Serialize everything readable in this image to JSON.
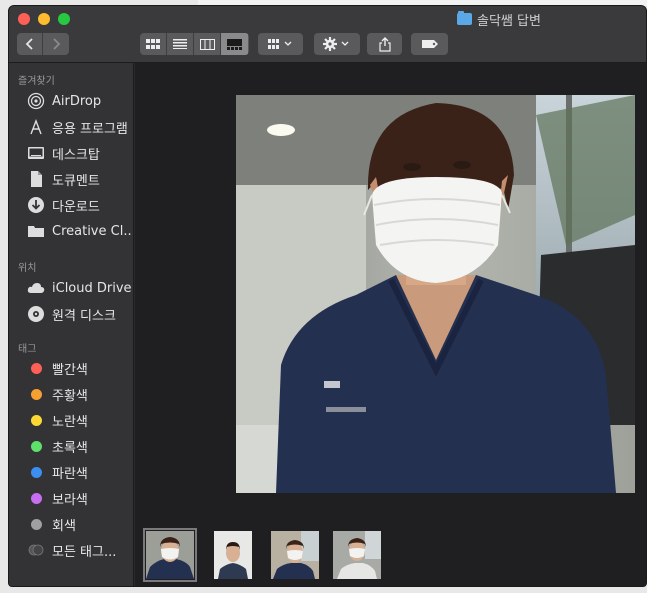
{
  "window": {
    "title": "솔닥쌤 답변"
  },
  "toolbar": {
    "back_icon": "chevron-left-icon",
    "forward_icon": "chevron-right-icon",
    "view_modes": [
      "icon-view",
      "list-view",
      "column-view",
      "gallery-view"
    ],
    "active_view": "gallery-view"
  },
  "sidebar": {
    "favorites_label": "즐겨찾기",
    "favorites": [
      {
        "label": "AirDrop",
        "icon": "airdrop-icon"
      },
      {
        "label": "응용 프로그램",
        "icon": "applications-icon"
      },
      {
        "label": "데스크탑",
        "icon": "desktop-icon"
      },
      {
        "label": "도큐멘트",
        "icon": "document-icon"
      },
      {
        "label": "다운로드",
        "icon": "download-icon"
      },
      {
        "label": "Creative Cl...",
        "icon": "folder-icon"
      }
    ],
    "locations_label": "위치",
    "locations": [
      {
        "label": "iCloud Drive",
        "icon": "cloud-icon"
      },
      {
        "label": "원격 디스크",
        "icon": "disc-icon"
      }
    ],
    "tags_label": "태그",
    "tags": [
      {
        "label": "빨간색",
        "color": "#fe5f57"
      },
      {
        "label": "주황색",
        "color": "#f7a032"
      },
      {
        "label": "노란색",
        "color": "#fdd835"
      },
      {
        "label": "초록색",
        "color": "#5ee06a"
      },
      {
        "label": "파란색",
        "color": "#3b8ff2"
      },
      {
        "label": "보라색",
        "color": "#c86ef0"
      },
      {
        "label": "회색",
        "color": "#a0a0a2"
      },
      {
        "label": "모든 태그...",
        "color": "#555557"
      }
    ]
  },
  "colors": {
    "window_bg": "#1f1f21",
    "sidebar_bg": "#333335",
    "scrubs": "#24304f"
  }
}
